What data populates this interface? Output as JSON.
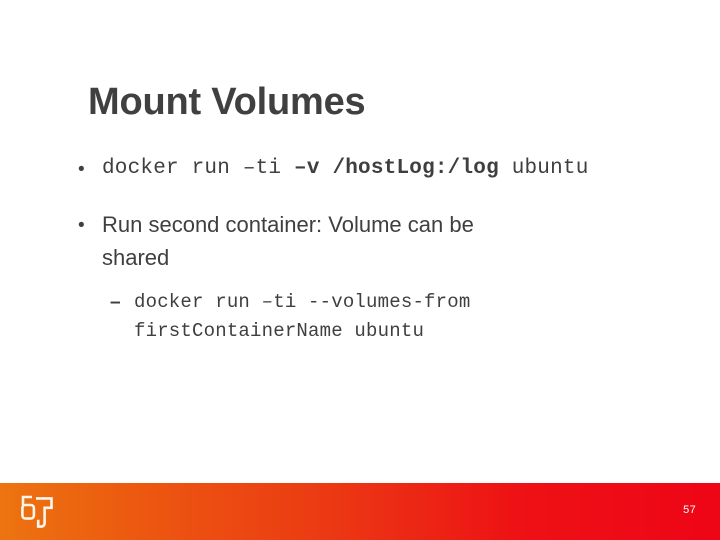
{
  "slide": {
    "title": "Mount Volumes",
    "page_number": "57",
    "background_color": "#ffffff",
    "title_color": "#404040",
    "body_text_color": "#3f3f3f"
  },
  "content": {
    "bullets": [
      {
        "marker": "•",
        "level": 1,
        "style": "mono",
        "segments": [
          {
            "text": "docker run –ti ",
            "bold": false
          },
          {
            "text": "–v",
            "bold": true
          },
          {
            "text": " ",
            "bold": false
          },
          {
            "text": "/hostLog:/log",
            "bold": true
          },
          {
            "text": " ubuntu",
            "bold": false
          }
        ],
        "plain_text": "docker run –ti –v /hostLog:/log ubuntu"
      },
      {
        "marker": "•",
        "level": 1,
        "style": "sans",
        "segments": [
          {
            "text": "Run second container: Volume can be shared",
            "bold": false
          }
        ],
        "plain_text": "Run second container: Volume can be shared"
      },
      {
        "marker": "–",
        "level": 2,
        "style": "mono",
        "segments": [
          {
            "text": "docker run –ti --volumes-from firstContainerName ubuntu",
            "bold": false
          }
        ],
        "plain_text": "docker run –ti --volumes-from firstContainerName ubuntu"
      }
    ]
  },
  "footer": {
    "logo_name": "company-monogram-logo",
    "gradient_start_color": "#ED7410",
    "gradient_end_color": "#EE0516",
    "page_number": "57"
  }
}
